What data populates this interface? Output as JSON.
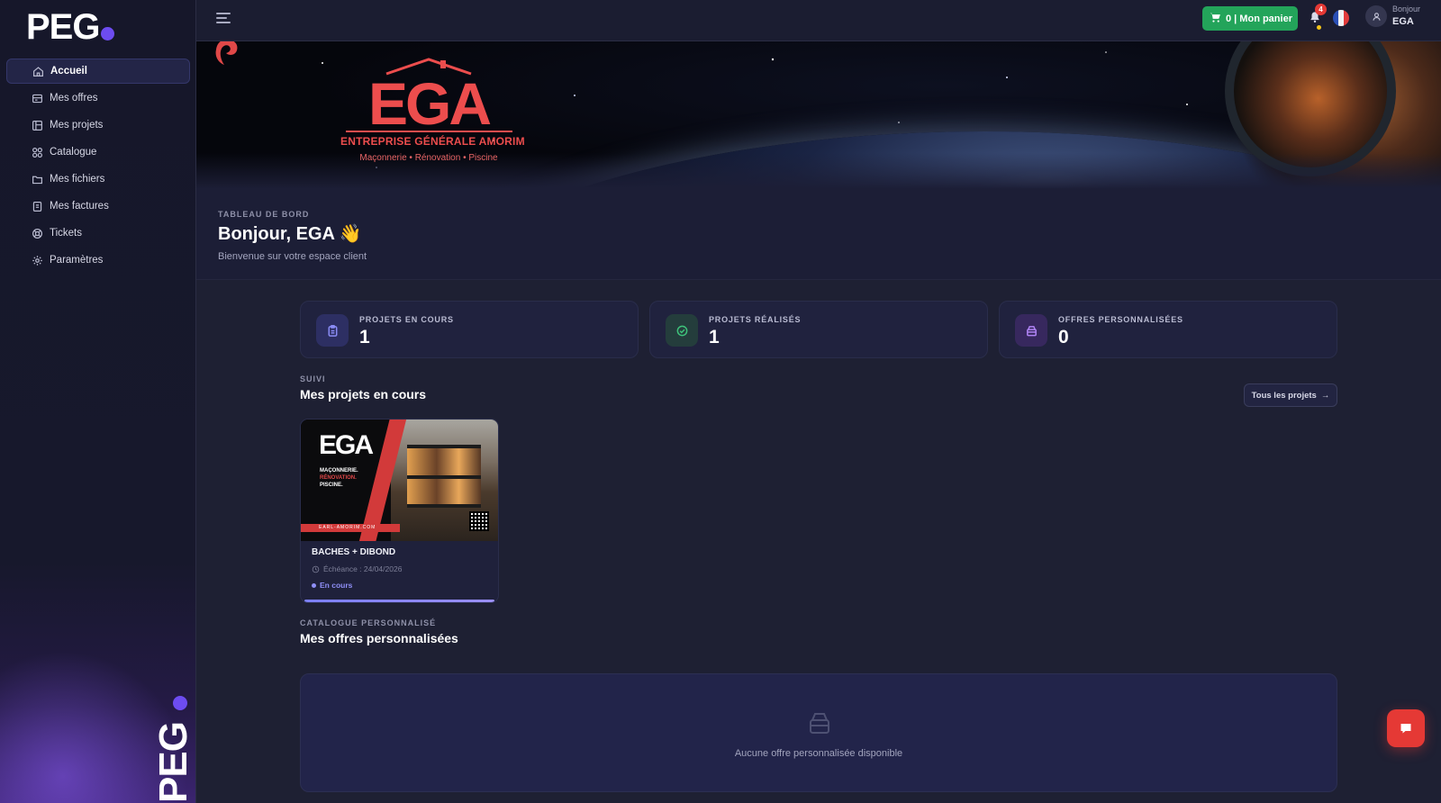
{
  "brand": {
    "logo_text": "PEG",
    "side_logo_text": "PEG"
  },
  "sidebar": {
    "items": [
      {
        "label": "Accueil",
        "icon": "home-icon",
        "active": true
      },
      {
        "label": "Mes offres",
        "icon": "offers-icon",
        "active": false
      },
      {
        "label": "Mes projets",
        "icon": "projects-icon",
        "active": false
      },
      {
        "label": "Catalogue",
        "icon": "grid-icon",
        "active": false
      },
      {
        "label": "Mes fichiers",
        "icon": "folder-icon",
        "active": false
      },
      {
        "label": "Mes factures",
        "icon": "invoice-icon",
        "active": false
      },
      {
        "label": "Tickets",
        "icon": "lifebuoy-icon",
        "active": false
      },
      {
        "label": "Paramètres",
        "icon": "gear-icon",
        "active": false
      }
    ]
  },
  "topbar": {
    "cart_label": "0 | Mon panier",
    "notifications_count": "4",
    "language": "fr",
    "user_greeting": "Bonjour",
    "user_name": "EGA"
  },
  "banner": {
    "company_logo": "EGA",
    "company_name": "ENTREPRISE GÉNÉRALE AMORIM",
    "company_tagline": "Maçonnerie • Rénovation • Piscine"
  },
  "header": {
    "eyebrow": "TABLEAU DE BORD",
    "title": "Bonjour, EGA 👋",
    "subtitle": "Bienvenue sur votre espace client"
  },
  "stats": [
    {
      "label": "PROJETS EN COURS",
      "value": "1",
      "icon": "clipboard-icon",
      "color": "#8a8cf5"
    },
    {
      "label": "PROJETS RÉALISÉS",
      "value": "1",
      "icon": "check-circle-icon",
      "color": "#3ec27a"
    },
    {
      "label": "OFFRES PERSONNALISÉES",
      "value": "0",
      "icon": "box-icon",
      "color": "#b084f5"
    }
  ],
  "projects_section": {
    "eyebrow": "SUIVI",
    "title": "Mes projets en cours",
    "all_button": "Tous les projets",
    "projects": [
      {
        "name": "BACHES + DIBOND",
        "deadline": "Échéance : 24/04/2026",
        "status": "En cours",
        "progress": 1.0,
        "image_text": {
          "logo": "EGA",
          "line1": "MAÇONNERIE.",
          "line2": "RÉNOVATION.",
          "line3": "PISCINE.",
          "url": "EARL-AMORIM.COM"
        }
      }
    ]
  },
  "offers_section": {
    "eyebrow": "CATALOGUE PERSONNALISÉ",
    "title": "Mes offres personnalisées",
    "empty_text": "Aucune offre personnalisée disponible"
  },
  "colors": {
    "accent": "#6d4cf0",
    "cart": "#23a45a",
    "danger": "#e53935",
    "brand_red": "#ec4d4d"
  }
}
